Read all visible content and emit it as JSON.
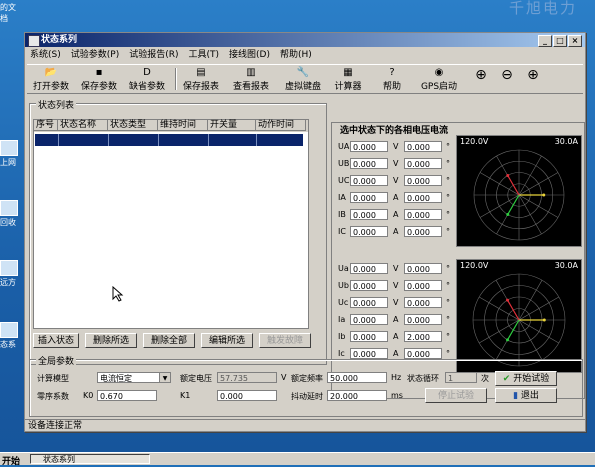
{
  "desktop": {
    "watermark": "千旭电力",
    "icons": [
      {
        "label": "的文档"
      },
      {
        "label": "上网"
      },
      {
        "label": "回收"
      },
      {
        "label": "远方"
      },
      {
        "label": "态系"
      }
    ]
  },
  "window": {
    "title": "状态系列",
    "controls": [
      "_",
      "□",
      "×"
    ]
  },
  "menu": [
    "系统(S)",
    "试验参数(P)",
    "试验报告(R)",
    "工具(T)",
    "接线图(D)",
    "帮助(H)"
  ],
  "toolbar": [
    {
      "label": "打开参数",
      "icon": "open-folder-icon",
      "glyph": "📂"
    },
    {
      "label": "保存参数",
      "icon": "save-icon",
      "glyph": "▪"
    },
    {
      "label": "缺省参数",
      "icon": "default-icon",
      "glyph": "D"
    },
    {
      "label": "保存报表",
      "icon": "save-report-icon",
      "glyph": "▤"
    },
    {
      "label": "查看报表",
      "icon": "view-report-icon",
      "glyph": "▥"
    },
    {
      "label": "虚拟键盘",
      "icon": "keyboard-icon",
      "glyph": "🔧"
    },
    {
      "label": "计算器",
      "icon": "calculator-icon",
      "glyph": "▦"
    },
    {
      "label": "帮助",
      "icon": "help-icon",
      "glyph": "?"
    },
    {
      "label": "GPS启动",
      "icon": "gps-icon",
      "glyph": "◉"
    }
  ],
  "zoom_icons": [
    "zoom-in-icon",
    "zoom-out-icon",
    "zoom-fit-icon"
  ],
  "state_list": {
    "caption": "状态列表",
    "columns": [
      "序号",
      "状态名称",
      "状态类型",
      "维持时间",
      "开关量",
      "动作时间"
    ],
    "buttons": [
      "插入状态",
      "删除所选",
      "删除全部",
      "编辑所选",
      "触发故障"
    ]
  },
  "phasor_panel": {
    "title": "选中状态下的各相电压电流",
    "group1": {
      "rows": [
        {
          "name": "UA",
          "mag": "0.000",
          "unit": "V",
          "ang": "0.000"
        },
        {
          "name": "UB",
          "mag": "0.000",
          "unit": "V",
          "ang": "0.000"
        },
        {
          "name": "UC",
          "mag": "0.000",
          "unit": "V",
          "ang": "0.000"
        },
        {
          "name": "IA",
          "mag": "0.000",
          "unit": "A",
          "ang": "0.000"
        },
        {
          "name": "IB",
          "mag": "0.000",
          "unit": "A",
          "ang": "0.000"
        },
        {
          "name": "IC",
          "mag": "0.000",
          "unit": "A",
          "ang": "0.000"
        }
      ],
      "scope": {
        "vscale": "120.0V",
        "iscale": "30.0A"
      }
    },
    "group2": {
      "rows": [
        {
          "name": "Ua",
          "mag": "0.000",
          "unit": "V",
          "ang": "0.000"
        },
        {
          "name": "Ub",
          "mag": "0.000",
          "unit": "V",
          "ang": "0.000"
        },
        {
          "name": "Uc",
          "mag": "0.000",
          "unit": "V",
          "ang": "0.000"
        },
        {
          "name": "Ia",
          "mag": "0.000",
          "unit": "A",
          "ang": "0.000"
        },
        {
          "name": "Ib",
          "mag": "0.000",
          "unit": "A",
          "ang": "2.000"
        },
        {
          "name": "Ic",
          "mag": "0.000",
          "unit": "A",
          "ang": "0.000"
        }
      ],
      "scope": {
        "vscale": "120.0V",
        "iscale": "30.0A"
      }
    },
    "degree": "°"
  },
  "global_params": {
    "caption": "全局参数",
    "calc_model_label": "计算模型",
    "calc_model_value": "电流恒定",
    "rated_voltage_label": "额定电压",
    "rated_voltage_value": "57.735",
    "rated_voltage_unit": "V",
    "rated_freq_label": "额定频率",
    "rated_freq_value": "50.000",
    "rated_freq_unit": "Hz",
    "cycle_label": "状态循环",
    "cycle_value": "1",
    "cycle_unit": "次",
    "zero_seq_label": "零序系数",
    "k0_label": "K0",
    "k0_value": "0.670",
    "k1_label": "K1",
    "k1_value": "0.000",
    "jitter_label": "抖动延时",
    "jitter_value": "20.000",
    "jitter_unit": "ms",
    "start_button": "开始试验",
    "stop_button": "停止试验",
    "exit_button": "退出"
  },
  "status": "设备连接正常",
  "taskbar": {
    "start": "开始",
    "task": "状态系列"
  },
  "colors": {
    "phasor_a": "#e8d23a",
    "phasor_b": "#2ecc40",
    "phasor_c": "#e0303a",
    "title_bar": "#0a246a"
  }
}
